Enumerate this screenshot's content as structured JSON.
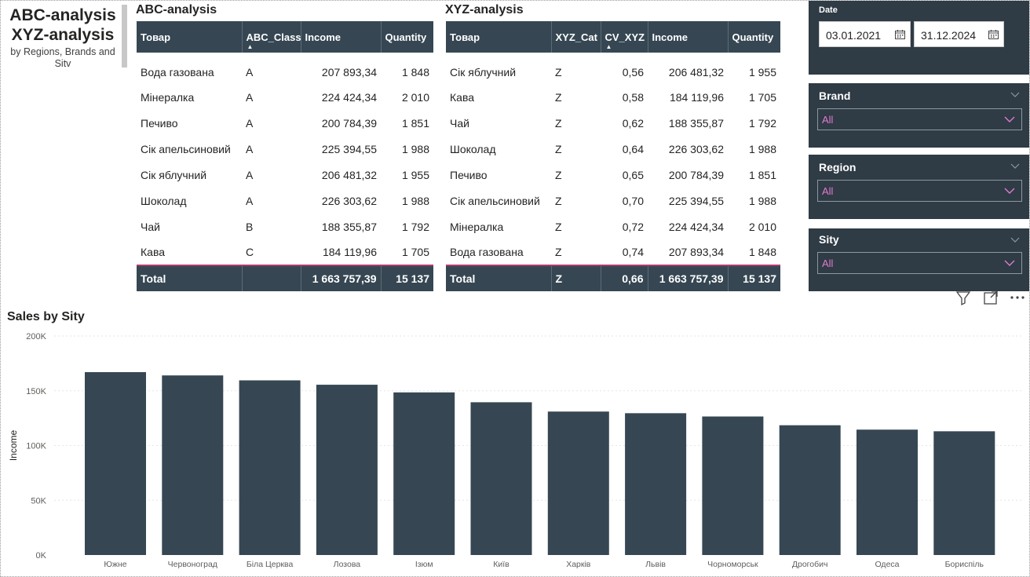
{
  "title_block": {
    "line1": "ABC-analysis",
    "line2": "XYZ-analysis",
    "subtitle": "by Regions, Brands and Sitv"
  },
  "abc_table": {
    "title": "ABC-analysis",
    "columns": [
      "Товар",
      "ABC_Class",
      "Income",
      "Quantity"
    ],
    "sorted_column": "ABC_Class",
    "rows": [
      [
        "Вода газована",
        "A",
        "207 893,34",
        "1 848"
      ],
      [
        "Мінералка",
        "A",
        "224 424,34",
        "2 010"
      ],
      [
        "Печиво",
        "A",
        "200 784,39",
        "1 851"
      ],
      [
        "Сік апельсиновий",
        "A",
        "225 394,55",
        "1 988"
      ],
      [
        "Сік яблучний",
        "A",
        "206 481,32",
        "1 955"
      ],
      [
        "Шоколад",
        "A",
        "226 303,62",
        "1 988"
      ],
      [
        "Чай",
        "B",
        "188 355,87",
        "1 792"
      ],
      [
        "Кава",
        "C",
        "184 119,96",
        "1 705"
      ]
    ],
    "total": [
      "Total",
      "",
      "1 663 757,39",
      "15 137"
    ]
  },
  "xyz_table": {
    "title": "XYZ-analysis",
    "columns": [
      "Товар",
      "XYZ_Cat",
      "CV_XYZ",
      "Income",
      "Quantity"
    ],
    "sorted_column": "CV_XYZ",
    "rows": [
      [
        "Сік яблучний",
        "Z",
        "0,56",
        "206 481,32",
        "1 955"
      ],
      [
        "Кава",
        "Z",
        "0,58",
        "184 119,96",
        "1 705"
      ],
      [
        "Чай",
        "Z",
        "0,62",
        "188 355,87",
        "1 792"
      ],
      [
        "Шоколад",
        "Z",
        "0,64",
        "226 303,62",
        "1 988"
      ],
      [
        "Печиво",
        "Z",
        "0,65",
        "200 784,39",
        "1 851"
      ],
      [
        "Сік апельсиновий",
        "Z",
        "0,70",
        "225 394,55",
        "1 988"
      ],
      [
        "Мінералка",
        "Z",
        "0,72",
        "224 424,34",
        "2 010"
      ],
      [
        "Вода газована",
        "Z",
        "0,74",
        "207 893,34",
        "1 848"
      ]
    ],
    "total": [
      "Total",
      "Z",
      "0,66",
      "1 663 757,39",
      "15 137"
    ]
  },
  "slicers": {
    "date": {
      "label": "Date",
      "start": "03.01.2021",
      "end": "31.12.2024"
    },
    "brand": {
      "label": "Brand",
      "value": "All"
    },
    "region": {
      "label": "Region",
      "value": "All"
    },
    "sity": {
      "label": "Sity",
      "value": "All"
    }
  },
  "icons": {
    "filter": "filter-icon",
    "focus": "focus-mode-icon",
    "more": "more-options-icon",
    "calendar": "calendar-icon",
    "chevron": "chevron-down-icon"
  },
  "colors": {
    "header_bg": "#364753",
    "bar": "#364753",
    "slicer_bg": "#2f3b45",
    "slicer_value": "#e07bd0",
    "total_border": "#b23a6a"
  },
  "chart_data": {
    "type": "bar",
    "title": "Sales by Sity",
    "xlabel": "",
    "ylabel": "Income",
    "ylim": [
      0,
      200000
    ],
    "yticks": [
      0,
      50000,
      100000,
      150000,
      200000
    ],
    "ytick_labels": [
      "0K",
      "50K",
      "100K",
      "150K",
      "200K"
    ],
    "grid": true,
    "categories": [
      "Южне",
      "Червоноград",
      "Біла Церква",
      "Лозова",
      "Ізюм",
      "Київ",
      "Харків",
      "Львів",
      "Чорноморськ",
      "Дрогобич",
      "Одеса",
      "Бориспіль"
    ],
    "values": [
      167000,
      164000,
      159500,
      155500,
      148500,
      139500,
      131000,
      129500,
      126500,
      118500,
      114500,
      113000
    ]
  }
}
